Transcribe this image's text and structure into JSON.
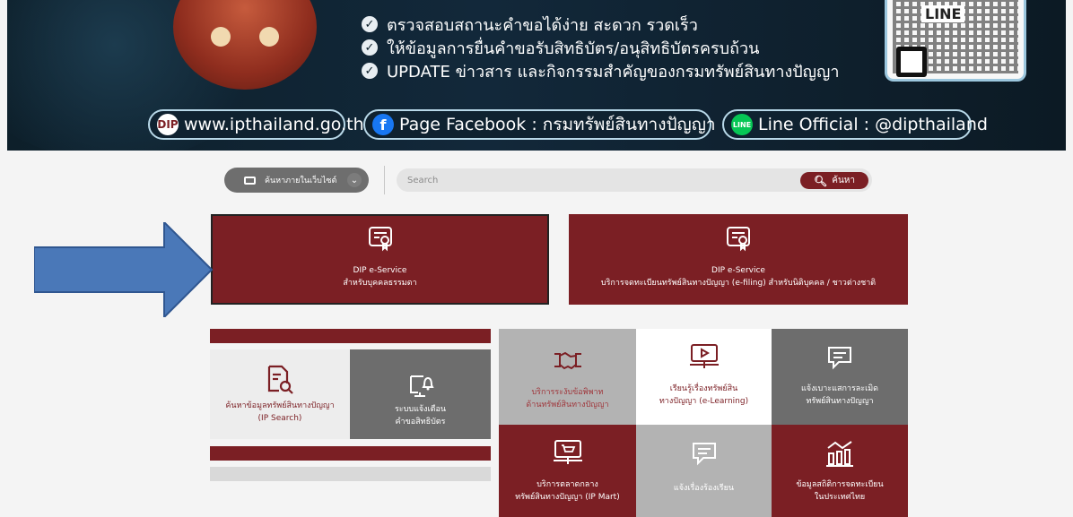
{
  "banner": {
    "bullets": [
      "ตรวจสอบสถานะคำขอได้ง่าย สะดวก รวดเร็ว",
      "ให้ข้อมูลการยื่นคำขอรับสิทธิบัตร/อนุสิทธิบัตรครบถ้วน",
      "UPDATE ข่าวสาร และกิจกรรมสำคัญของกรมทรัพย์สินทางปัญญา"
    ],
    "qr_label": "LINE",
    "website": "www.ipthailand.go.th",
    "facebook": "Page Facebook : กรมทรัพย์สินทางปัญญา",
    "line": "Line Official : @dipthailand"
  },
  "search": {
    "scope_label": "ค้นหาภายในเว็บไซต์",
    "placeholder": "Search",
    "button_label": "ค้นหา"
  },
  "services": {
    "eservice_person": {
      "title": "DIP e-Service",
      "subtitle": "สำหรับบุคคลธรรมดา"
    },
    "eservice_corp": {
      "title": "DIP e-Service",
      "subtitle": "บริการจดทะเบียนทรัพย์สินทางปัญญา (e-filing) สำหรับนิติบุคคล / ชาวต่างชาติ"
    }
  },
  "tiles": {
    "ip_search": {
      "line1": "ค้นหาข้อมูลทรัพย์สินทางปัญญา",
      "line2": "(IP Search)"
    },
    "notify": {
      "line1": "ระบบแจ้งเตือน",
      "line2": "คำขอสิทธิบัตร"
    },
    "dispute": {
      "line1": "บริการระงับข้อพิพาท",
      "line2": "ด้านทรัพย์สินทางปัญญา"
    },
    "elearning": {
      "line1": "เรียนรู้เรื่องทรัพย์สิน",
      "line2": "ทางปัญญา (e-Learning)"
    },
    "report_piracy": {
      "line1": "แจ้งเบาะแสการละเมิด",
      "line2": "ทรัพย์สินทางปัญญา"
    },
    "ip_mart": {
      "line1": "บริการตลาดกลาง",
      "line2": "ทรัพย์สินทางปัญญา (IP Mart)"
    },
    "complaint": {
      "line1": "แจ้งเรื่องร้องเรียน"
    },
    "statistics": {
      "line1": "ข้อมูลสถิติการจดทะเบียน",
      "line2": "ในประเทศไทย"
    }
  },
  "colors": {
    "brand_red": "#7b1f24",
    "tile_gray": "#6d6d6d",
    "arrow_blue": "#4a78b8"
  }
}
